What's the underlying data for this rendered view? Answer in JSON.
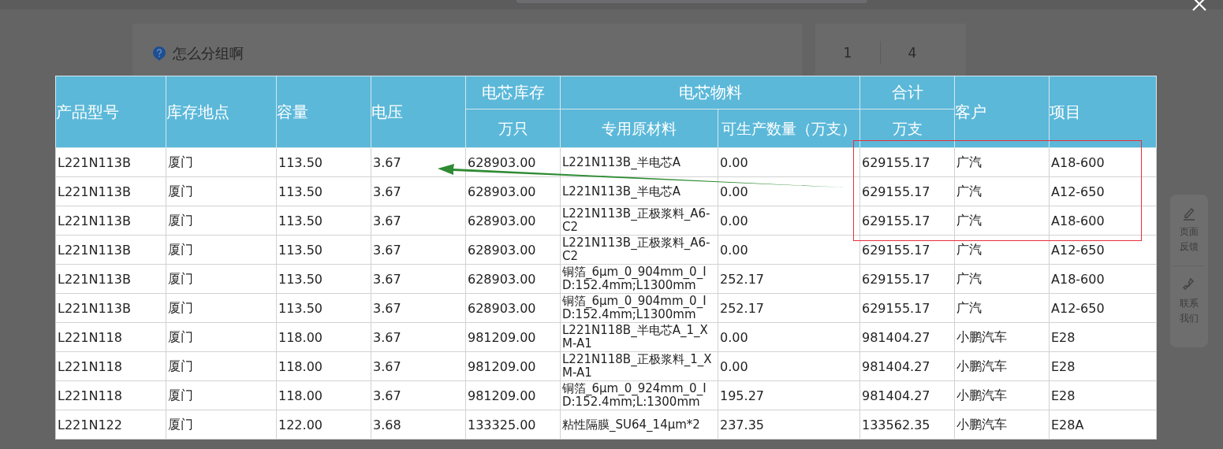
{
  "background": {
    "question": "怎么分组啊",
    "counts": [
      "1",
      "4"
    ]
  },
  "side_panel": [
    {
      "kind": "feedback",
      "label": "页面反馈"
    },
    {
      "kind": "contact",
      "label": "联系我们"
    }
  ],
  "header": [
    {
      "label": "产品型号"
    },
    {
      "label": "库存地点"
    },
    {
      "label": "容量"
    },
    {
      "label": "电压"
    },
    {
      "label": "电芯库存",
      "children": [
        {
          "label": "万只"
        }
      ]
    },
    {
      "label": "电芯物料",
      "children": [
        {
          "label": "专用原材料"
        },
        {
          "label": "可生产数量（万支）"
        }
      ]
    },
    {
      "label": "合计",
      "children": [
        {
          "label": "万支"
        }
      ]
    },
    {
      "label": "客户"
    },
    {
      "label": "项目"
    }
  ],
  "rows": [
    {
      "cells": [
        "L221N113B",
        "厦门",
        "113.50",
        "3.67",
        "628903.00",
        "L221N113B_半电芯A",
        "0.00",
        "629155.17",
        "广汽",
        "A18-600"
      ]
    },
    {
      "cells": [
        "L221N113B",
        "厦门",
        "113.50",
        "3.67",
        "628903.00",
        "L221N113B_半电芯A",
        "0.00",
        "629155.17",
        "广汽",
        "A12-650"
      ]
    },
    {
      "cells": [
        "L221N113B",
        "厦门",
        "113.50",
        "3.67",
        "628903.00",
        "L221N113B_正极浆料_A6-C2",
        "0.00",
        "629155.17",
        "广汽",
        "A18-600"
      ]
    },
    {
      "cells": [
        "L221N113B",
        "厦门",
        "113.50",
        "3.67",
        "628903.00",
        "L221N113B_正极浆料_A6-C2",
        "0.00",
        "629155.17",
        "广汽",
        "A12-650"
      ]
    },
    {
      "cells": [
        "L221N113B",
        "厦门",
        "113.50",
        "3.67",
        "628903.00",
        "铜箔_6μm_0_904mm_0_ID:152.4mm;L1300mm",
        "252.17",
        "629155.17",
        "广汽",
        "A18-600"
      ]
    },
    {
      "cells": [
        "L221N113B",
        "厦门",
        "113.50",
        "3.67",
        "628903.00",
        "铜箔_6μm_0_904mm_0_ID:152.4mm;L1300mm",
        "252.17",
        "629155.17",
        "广汽",
        "A12-650"
      ]
    },
    {
      "cells": [
        "L221N118",
        "厦门",
        "118.00",
        "3.67",
        "981209.00",
        "L221N118B_半电芯A_1_XM-A1",
        "0.00",
        "981404.27",
        "小鹏汽车",
        "E28"
      ]
    },
    {
      "cells": [
        "L221N118",
        "厦门",
        "118.00",
        "3.67",
        "981209.00",
        "L221N118B_正极浆料_1_XM-A1",
        "0.00",
        "981404.27",
        "小鹏汽车",
        "E28"
      ]
    },
    {
      "cells": [
        "L221N118",
        "厦门",
        "118.00",
        "3.67",
        "981209.00",
        "铜箔_6μm_0_924mm_0_ID:152.4mm;L:1300mm",
        "195.27",
        "981404.27",
        "小鹏汽车",
        "E28"
      ]
    },
    {
      "cells": [
        "L221N122",
        "厦门",
        "122.00",
        "3.68",
        "133325.00",
        "粘性隔膜_SU64_14μm*2",
        "237.35",
        "133562.35",
        "小鹏汽车",
        "E28A"
      ]
    }
  ]
}
